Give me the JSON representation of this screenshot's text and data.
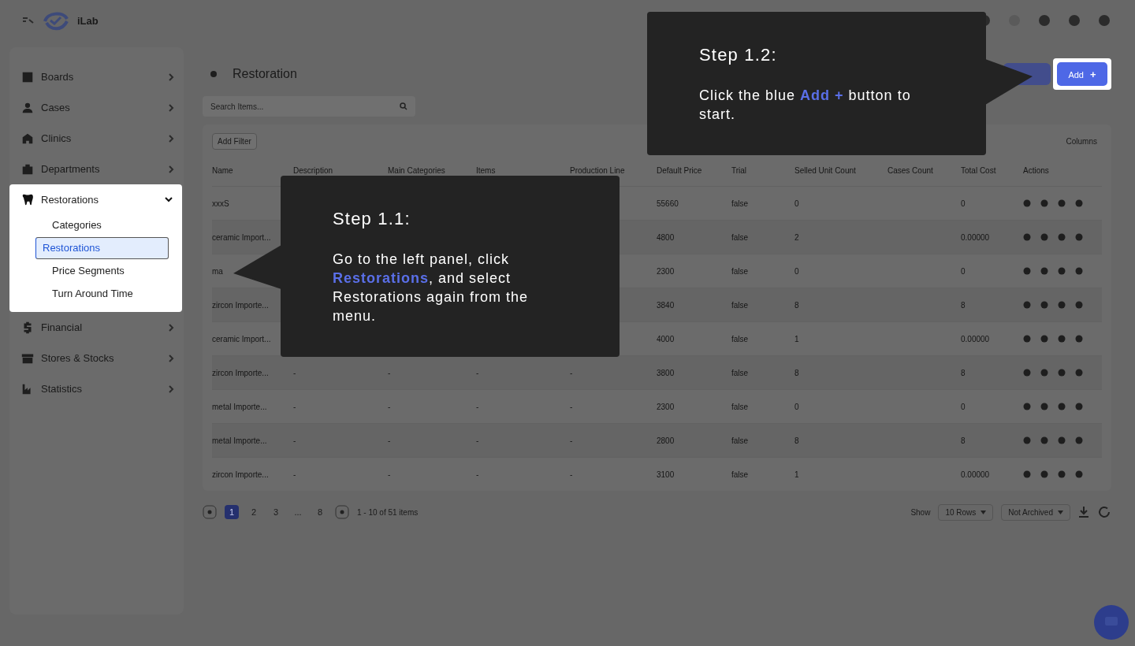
{
  "header": {
    "brand": "iLab"
  },
  "sidebar": {
    "items": [
      {
        "label": "Boards",
        "kind": "board",
        "expanded": false
      },
      {
        "label": "Cases",
        "kind": "user",
        "expanded": false
      },
      {
        "label": "Clinics",
        "kind": "building",
        "expanded": false
      },
      {
        "label": "Departments",
        "kind": "briefcase",
        "expanded": false
      },
      {
        "label": "Restorations",
        "kind": "tooth",
        "expanded": true,
        "children": [
          {
            "label": "Categories",
            "selected": false
          },
          {
            "label": "Restorations",
            "selected": true
          },
          {
            "label": "Price Segments",
            "selected": false
          },
          {
            "label": "Turn Around Time",
            "selected": false
          }
        ]
      },
      {
        "label": "Financial",
        "kind": "dollar",
        "expanded": false
      },
      {
        "label": "Stores & Stocks",
        "kind": "store",
        "expanded": false
      },
      {
        "label": "Statistics",
        "kind": "chart",
        "expanded": false
      }
    ]
  },
  "page": {
    "title": "Restoration",
    "search_placeholder": "Search Items...",
    "add_button": {
      "label": "Add",
      "icon": "+"
    }
  },
  "toolbar": {
    "filter_button": "Add Filter",
    "columns_button": "Columns"
  },
  "table": {
    "columns": [
      "Name",
      "Description",
      "Main Categories",
      "Items",
      "Production Line",
      "Default Price",
      "Trial",
      "Selled Unit Count",
      "Cases Count",
      "Total Cost",
      "Actions"
    ],
    "rows": [
      [
        "xxxS",
        null,
        null,
        null,
        null,
        "55660",
        "false",
        "0",
        null,
        "0"
      ],
      [
        "ceramic Import...",
        null,
        null,
        null,
        null,
        "4800",
        "false",
        "2",
        null,
        "0.00000"
      ],
      [
        "ma",
        null,
        null,
        null,
        null,
        "2300",
        "false",
        "0",
        null,
        "0"
      ],
      [
        "zircon Importe...",
        null,
        null,
        null,
        null,
        "3840",
        "false",
        "8",
        null,
        "8"
      ],
      [
        "ceramic Import...",
        null,
        null,
        null,
        null,
        "4000",
        "false",
        "1",
        null,
        "0.00000"
      ],
      [
        "zircon Importe...",
        "-",
        "-",
        "-",
        "-",
        "3800",
        "false",
        "8",
        null,
        "8"
      ],
      [
        "metal Importe...",
        "-",
        "-",
        "-",
        "-",
        "2300",
        "false",
        "0",
        null,
        "0"
      ],
      [
        "metal Importe...",
        "-",
        "-",
        "-",
        "-",
        "2800",
        "false",
        "8",
        null,
        "8"
      ],
      [
        "zircon Importe...",
        "-",
        "-",
        "-",
        "-",
        "3100",
        "false",
        "1",
        null,
        "0.00000"
      ]
    ]
  },
  "pagination": {
    "pages": [
      {
        "label": "1",
        "selected": true
      },
      {
        "label": "2",
        "selected": false
      },
      {
        "label": "3",
        "selected": false
      },
      {
        "label": "...",
        "selected": false
      },
      {
        "label": "8",
        "selected": false
      }
    ],
    "summary": "1 - 10 of 51 items",
    "show_label": "Show",
    "rows_select": "10 Rows",
    "archive_select": "Not Archived"
  },
  "tutorial": [
    {
      "title": "Step 1.1:",
      "text": "Go to the left panel, click **Restorations**, and select Restorations again from the menu.",
      "kind": "left"
    },
    {
      "title": "Step 1.2:",
      "text": "Click the blue **Add +** button to start.",
      "kind": "right"
    }
  ]
}
